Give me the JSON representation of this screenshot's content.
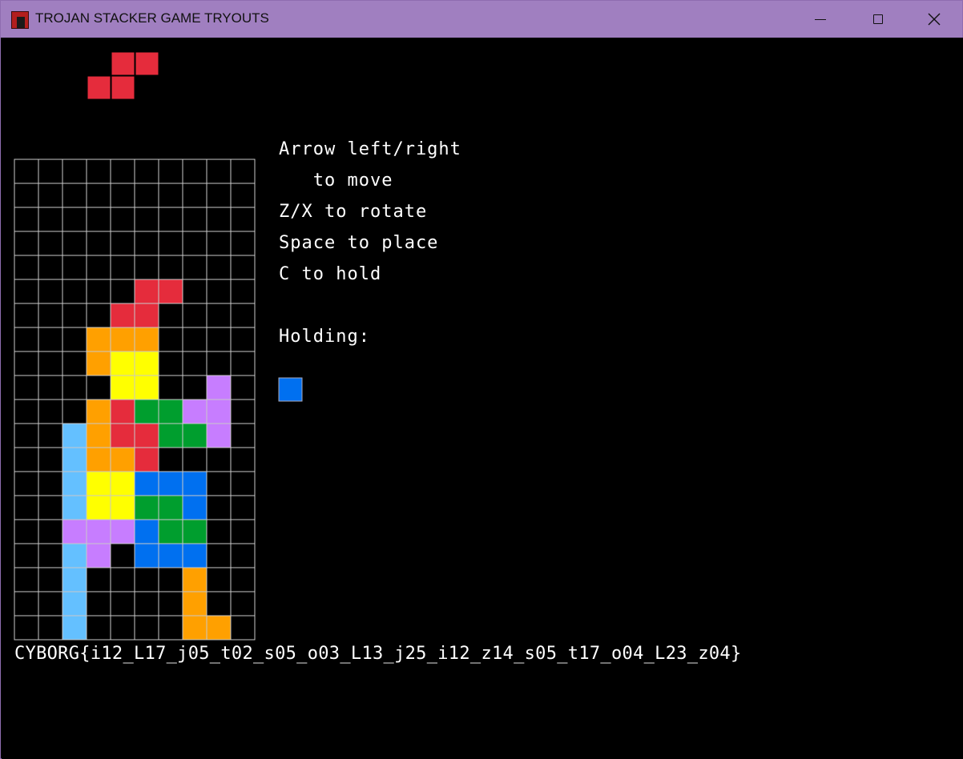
{
  "window": {
    "title": "TROJAN STACKER GAME TRYOUTS",
    "icon": "game-app-icon"
  },
  "colors": {
    "R": "#e52c3c",
    "O": "#ffa000",
    "Y": "#ffff00",
    "G": "#009e2e",
    "B": "#0070f0",
    "C": "#64c0ff",
    "P": "#c77dff",
    "grid": "#c8c8c8",
    "background": "#000000",
    "text": "#ffffff",
    "titlebar": "#a07fc0"
  },
  "next_piece": {
    "color": "R",
    "rows": [
      ".RR",
      "RR."
    ]
  },
  "board": {
    "cols": 10,
    "rows": [
      "..........",
      "..........",
      "..........",
      "..........",
      "..........",
      ".....RR...",
      "....RR....",
      "...OOO....",
      "...OYY....",
      "....YY..P.",
      "...ORGGPP.",
      "..CORRGGP.",
      "..COOR....",
      "..CYYBBB..",
      "..CYYGGB..",
      "..PPPBGG..",
      "..CP.BBB..",
      "..C....O..",
      "..C....O..",
      "..C....OO."
    ]
  },
  "instructions": {
    "line1": "Arrow left/right",
    "line2": "   to move",
    "line3": "Z/X to rotate",
    "line4": "Space to place",
    "line5": "C to hold",
    "holding_label": "Holding:"
  },
  "hold_piece": {
    "color": "B"
  },
  "flag_text": "CYBORG{i12_L17_j05_t02_s05_o03_L13_j25_i12_z14_s05_t17_o04_L23_z04}"
}
